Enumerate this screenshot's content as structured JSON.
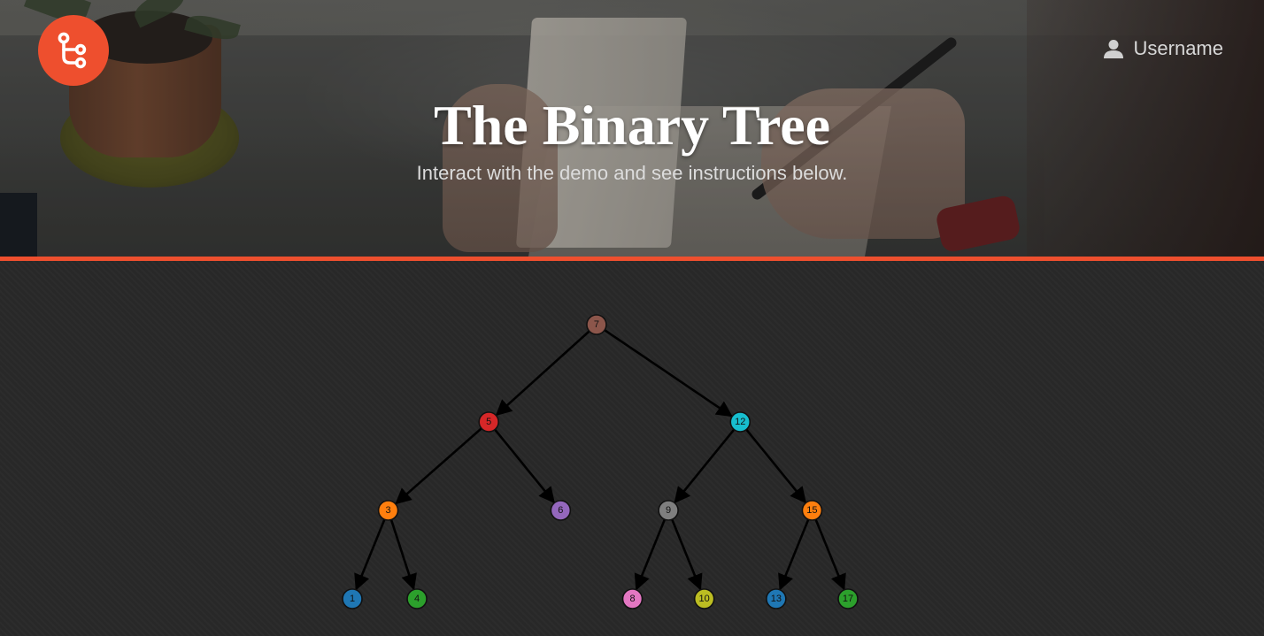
{
  "header": {
    "title": "The Binary Tree",
    "subtitle": "Interact with the demo and see instructions below.",
    "username": "Username",
    "accent_color": "#ee4f2e",
    "logo_icon": "tree-branch-icon",
    "user_icon": "user-icon"
  },
  "tree": {
    "root": "7",
    "nodes": [
      {
        "label": "7",
        "color": "#8c564b"
      },
      {
        "label": "5",
        "color": "#d62728"
      },
      {
        "label": "12",
        "color": "#17becf"
      },
      {
        "label": "3",
        "color": "#ff7f0e"
      },
      {
        "label": "6",
        "color": "#9467bd"
      },
      {
        "label": "9",
        "color": "#7f7f7f"
      },
      {
        "label": "15",
        "color": "#ff7f0e"
      },
      {
        "label": "1",
        "color": "#1f77b4"
      },
      {
        "label": "4",
        "color": "#2ca02c"
      },
      {
        "label": "8",
        "color": "#e377c2"
      },
      {
        "label": "10",
        "color": "#bcbd22"
      },
      {
        "label": "13",
        "color": "#1f77b4"
      },
      {
        "label": "17",
        "color": "#2ca02c"
      }
    ],
    "edges": [
      [
        "7",
        "5"
      ],
      [
        "7",
        "12"
      ],
      [
        "5",
        "3"
      ],
      [
        "5",
        "6"
      ],
      [
        "12",
        "9"
      ],
      [
        "12",
        "15"
      ],
      [
        "3",
        "1"
      ],
      [
        "3",
        "4"
      ],
      [
        "9",
        "8"
      ],
      [
        "9",
        "10"
      ],
      [
        "15",
        "13"
      ],
      [
        "15",
        "17"
      ]
    ]
  }
}
